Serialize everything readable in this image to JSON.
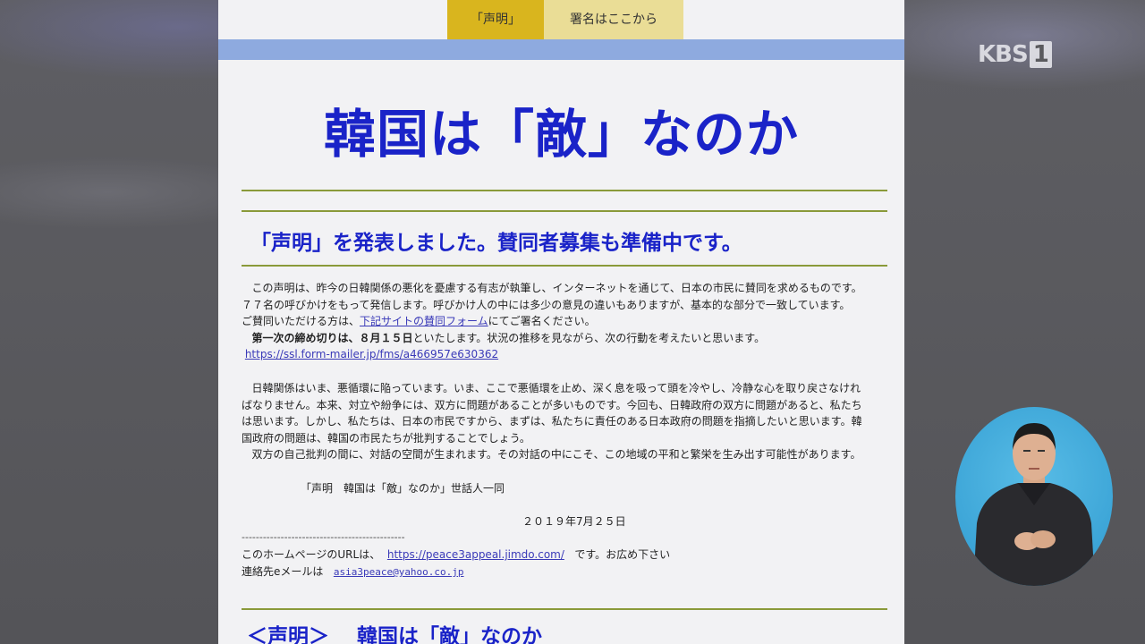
{
  "broadcast": {
    "logo_text": "KBS",
    "logo_channel": "1"
  },
  "nav": {
    "tabs": [
      {
        "label": "「声明」",
        "active": true
      },
      {
        "label": "署名はここから",
        "active": false
      }
    ]
  },
  "page": {
    "title": "韓国は「敵」なのか",
    "subtitle": "「声明」を発表しました。賛同者募集も準備中です。",
    "intro": {
      "line1": "この声明は、昨今の日韓関係の悪化を憂慮する有志が執筆し、インターネットを通じて、日本の市民に賛同を求めるものです。",
      "line2": "７７名の呼びかけをもって発信します。呼びかけ人の中には多少の意見の違いもありますが、基本的な部分で一致しています。",
      "line3_prefix": "ご賛同いただける方は、",
      "line3_link": "下記サイトの賛同フォーム",
      "line3_suffix": "にてご署名ください。",
      "line4_bold": "第一次の締め切りは、８月１５日",
      "line4_rest": "といたします。状況の推移を見ながら、次の行動を考えたいと思います。",
      "form_url": "https://ssl.form-mailer.jp/fms/a466957e630362"
    },
    "statement": {
      "line1": "日韓関係はいま、悪循環に陥っています。いま、ここで悪循環を止め、深く息を吸って頭を冷やし、冷静な心を取り戻さなけれ",
      "line2": "ばなりません。本来、対立や紛争には、双方に問題があることが多いものです。今回も、日韓政府の双方に問題があると、私たち",
      "line3": "は思います。しかし、私たちは、日本の市民ですから、まずは、私たちに責任のある日本政府の問題を指摘したいと思います。韓",
      "line4": "国政府の問題は、韓国の市民たちが批判することでしょう。",
      "line5": "双方の自己批判の間に、対話の空間が生まれます。その対話の中にこそ、この地域の平和と繁栄を生み出す可能性があります。"
    },
    "signature": "「声明　韓国は「敵」なのか」世話人一同",
    "date": "２０１９年7月２５日",
    "separator": "----------------------------------------------",
    "homepage": {
      "prefix": "このホームページのURLは、",
      "url": "https://peace3appeal.jimdo.com/",
      "suffix": "です。お広め下さい"
    },
    "contact": {
      "label": "連絡先eメールは",
      "email": "asia3peace@yahoo.co.jp"
    },
    "bottom_heading": "＜声明＞　 韓国は「敵」なのか"
  },
  "colors": {
    "title_blue": "#1a23c8",
    "tab_active": "#d9b51e",
    "tab_inactive": "#eadd96",
    "band": "#8eaadf",
    "rule": "#8a9a3a"
  }
}
